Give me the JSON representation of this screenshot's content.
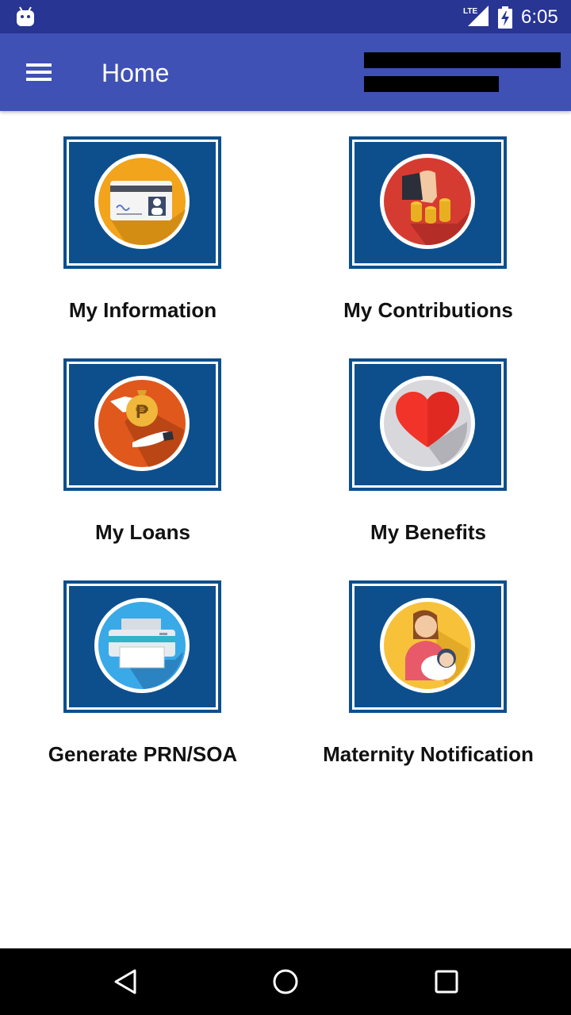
{
  "status_bar": {
    "time": "6:05",
    "network": "LTE",
    "icons": [
      "android-icon",
      "lte-signal-icon",
      "battery-charging-icon"
    ],
    "color": "#283593"
  },
  "app_bar": {
    "title": "Home",
    "menu_icon": "hamburger-menu-icon",
    "color": "#3f51b5",
    "user_info_redacted": true
  },
  "menu": [
    {
      "label": "My Information",
      "icon": "id-card-icon"
    },
    {
      "label": "My Contributions",
      "icon": "coins-icon"
    },
    {
      "label": "My Loans",
      "icon": "peso-money-bag-icon"
    },
    {
      "label": "My Benefits",
      "icon": "heart-icon"
    },
    {
      "label": "Generate PRN/SOA",
      "icon": "printer-icon"
    },
    {
      "label": "Maternity Notification",
      "icon": "mother-baby-icon"
    }
  ],
  "nav_bar": {
    "buttons": [
      "back-icon",
      "home-icon",
      "recents-icon"
    ]
  },
  "colors": {
    "tile_background": "#0d4f8c",
    "label_text": "#111111"
  }
}
